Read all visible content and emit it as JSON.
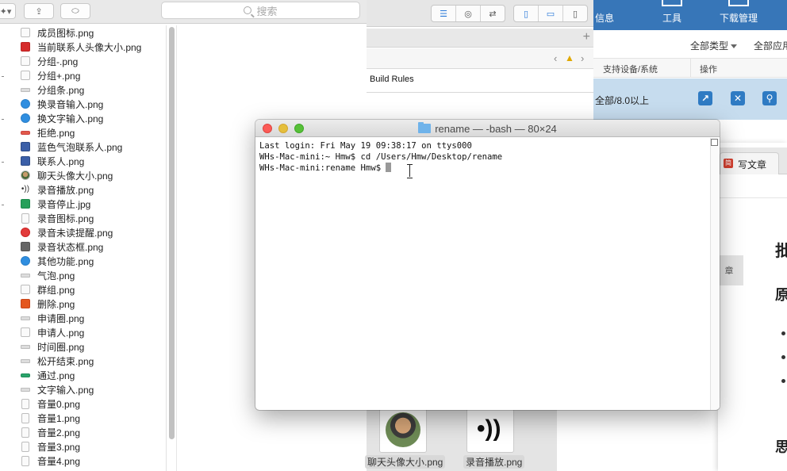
{
  "finder": {
    "search_placeholder": "搜索",
    "files": [
      {
        "name": "成员图标.png",
        "icon": "image-file-icon",
        "kind": "plain"
      },
      {
        "name": "当前联系人头像大小.png",
        "icon": "image-file-icon",
        "kind": "red"
      },
      {
        "name": "分组-.png",
        "icon": "image-file-icon",
        "kind": "plain"
      },
      {
        "name": "分组+.png",
        "icon": "image-file-icon",
        "kind": "plain"
      },
      {
        "name": "分组条.png",
        "icon": "image-file-icon",
        "kind": "line"
      },
      {
        "name": "换录音输入.png",
        "icon": "image-file-icon",
        "kind": "blue"
      },
      {
        "name": "换文字输入.png",
        "icon": "image-file-icon",
        "kind": "blue"
      },
      {
        "name": "拒绝.png",
        "icon": "image-file-icon",
        "kind": "redline"
      },
      {
        "name": "蓝色气泡联系人.png",
        "icon": "image-file-icon",
        "kind": "navy"
      },
      {
        "name": "联系人.png",
        "icon": "image-file-icon",
        "kind": "navy"
      },
      {
        "name": "聊天头像大小.png",
        "icon": "image-file-icon",
        "kind": "avatar"
      },
      {
        "name": "录音播放.png",
        "icon": "image-file-icon",
        "kind": "sound"
      },
      {
        "name": "录音停止.jpg",
        "icon": "image-file-icon",
        "kind": "green"
      },
      {
        "name": "录音图标.png",
        "icon": "image-file-icon",
        "kind": "doc"
      },
      {
        "name": "录音未读提醒.png",
        "icon": "image-file-icon",
        "kind": "circle-red"
      },
      {
        "name": "录音状态框.png",
        "icon": "image-file-icon",
        "kind": "gray"
      },
      {
        "name": "其他功能.png",
        "icon": "image-file-icon",
        "kind": "blue"
      },
      {
        "name": "气泡.png",
        "icon": "image-file-icon",
        "kind": "line"
      },
      {
        "name": "群组.png",
        "icon": "image-file-icon",
        "kind": "plain"
      },
      {
        "name": "删除.png",
        "icon": "image-file-icon",
        "kind": "orange"
      },
      {
        "name": "申请圈.png",
        "icon": "image-file-icon",
        "kind": "line"
      },
      {
        "name": "申请人.png",
        "icon": "image-file-icon",
        "kind": "plain"
      },
      {
        "name": "时间圈.png",
        "icon": "image-file-icon",
        "kind": "line"
      },
      {
        "name": "松开结束.png",
        "icon": "image-file-icon",
        "kind": "line"
      },
      {
        "name": "通过.png",
        "icon": "image-file-icon",
        "kind": "teal-line"
      },
      {
        "name": "文字输入.png",
        "icon": "image-file-icon",
        "kind": "line"
      },
      {
        "name": "音量0.png",
        "icon": "image-file-icon",
        "kind": "doc"
      },
      {
        "name": "音量1.png",
        "icon": "image-file-icon",
        "kind": "doc"
      },
      {
        "name": "音量2.png",
        "icon": "image-file-icon",
        "kind": "doc"
      },
      {
        "name": "音量3.png",
        "icon": "image-file-icon",
        "kind": "doc"
      },
      {
        "name": "音量4.png",
        "icon": "image-file-icon",
        "kind": "doc"
      }
    ]
  },
  "xcode": {
    "build_rules_label": "Build Rules",
    "drop_items": [
      {
        "label": "聊天头像大小.png"
      },
      {
        "label": "录音播放.png"
      }
    ]
  },
  "web": {
    "nav": [
      "信息",
      "工具",
      "下载管理"
    ],
    "filters": [
      "全部类型",
      "全部应用"
    ],
    "columns": [
      "支持设备/系统",
      "操作"
    ],
    "row_value": "全部/8.0以上",
    "colors": {
      "topbar": "#3776b8",
      "row_highlight": "#c6dcee",
      "action_button": "#2f7bc3"
    }
  },
  "editor": {
    "tab_label": "写文章",
    "tab_icon_text": "简",
    "side_tag": "章",
    "headings": [
      "批",
      "原",
      "思"
    ]
  },
  "terminal": {
    "title": "rename — -bash — 80×24",
    "lines": [
      "Last login: Fri May 19 09:38:17 on ttys000",
      "WHs-Mac-mini:~ Hmw$ cd /Users/Hmw/Desktop/rename",
      "WHs-Mac-mini:rename Hmw$ "
    ]
  }
}
